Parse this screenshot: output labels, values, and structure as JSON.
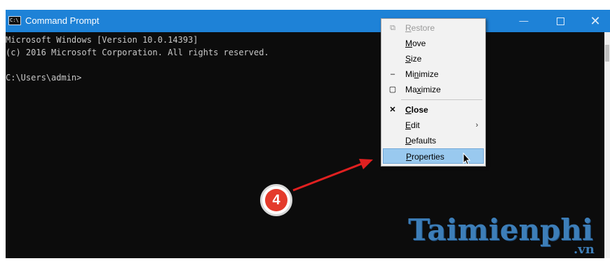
{
  "window": {
    "title": "Command Prompt",
    "icon": "cmd-icon",
    "caption_buttons": {
      "minimize": "—",
      "maximize": "maximize-icon",
      "close": "✕"
    }
  },
  "console": {
    "lines": [
      "Microsoft Windows [Version 10.0.14393]",
      "(c) 2016 Microsoft Corporation. All rights reserved.",
      "",
      "C:\\Users\\admin>"
    ]
  },
  "system_menu": {
    "items": [
      {
        "glyph": "⧉",
        "label": "Restore",
        "state": "disabled"
      },
      {
        "glyph": "",
        "label": "Move",
        "state": "normal"
      },
      {
        "glyph": "",
        "label": "Size",
        "state": "normal"
      },
      {
        "glyph": "‒",
        "label": "Minimize",
        "state": "normal"
      },
      {
        "glyph": "▢",
        "label": "Maximize",
        "state": "normal"
      },
      {
        "glyph": "✕",
        "label": "Close",
        "state": "bold"
      },
      {
        "glyph": "",
        "label": "Edit",
        "submenu": "›",
        "state": "normal"
      },
      {
        "glyph": "",
        "label": "Defaults",
        "state": "normal"
      },
      {
        "glyph": "",
        "label": "Properties",
        "state": "highlighted"
      }
    ]
  },
  "annotation": {
    "step_number": "4",
    "arrow_color": "#e02020"
  },
  "watermark": {
    "main": "Taimienphi",
    "sub": ".vn"
  },
  "colors": {
    "titlebar": "#1e82d7",
    "console_bg": "#0c0c0c",
    "console_text": "#c8c8c8",
    "menu_bg": "#f2f2f2",
    "menu_highlight": "#99c9ef",
    "badge": "#e43b2c",
    "watermark": "#3d7eb8"
  }
}
